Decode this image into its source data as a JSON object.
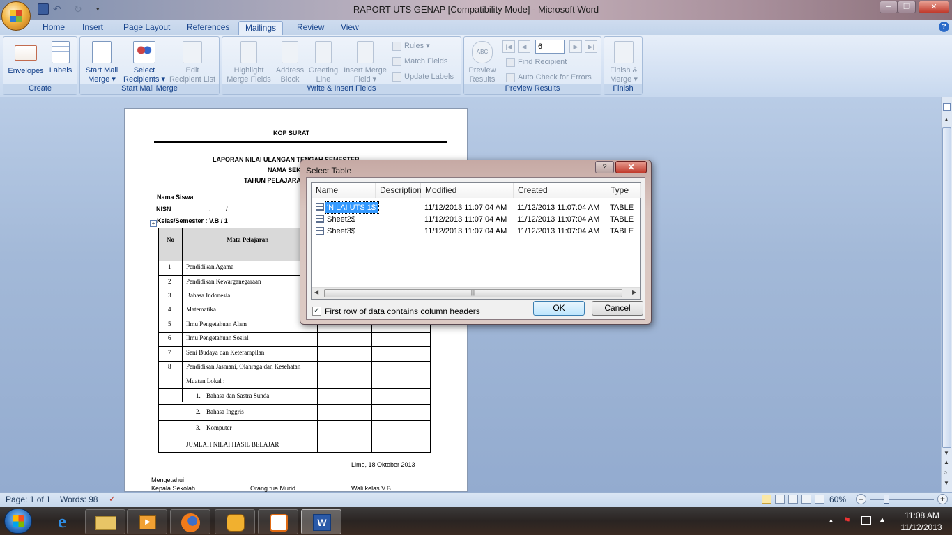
{
  "window": {
    "title": "RAPORT UTS GENAP [Compatibility Mode] - Microsoft Word"
  },
  "tabs": [
    "Home",
    "Insert",
    "Page Layout",
    "References",
    "Mailings",
    "Review",
    "View"
  ],
  "ribbon": {
    "create": {
      "label": "Create",
      "envelopes": "Envelopes",
      "labels": "Labels"
    },
    "start_mail_merge": {
      "label": "Start Mail Merge",
      "start_l1": "Start Mail",
      "start_l2": "Merge ▾",
      "select_l1": "Select",
      "select_l2": "Recipients ▾",
      "edit_l1": "Edit",
      "edit_l2": "Recipient List"
    },
    "write_insert": {
      "label": "Write & Insert Fields",
      "highlight_l1": "Highlight",
      "highlight_l2": "Merge Fields",
      "address_l1": "Address",
      "address_l2": "Block",
      "greeting_l1": "Greeting",
      "greeting_l2": "Line",
      "insert_l1": "Insert Merge",
      "insert_l2": "Field ▾",
      "rules": "Rules ▾",
      "match": "Match Fields",
      "update": "Update Labels"
    },
    "preview": {
      "label": "Preview Results",
      "preview_l1": "Preview",
      "preview_l2": "Results",
      "record": "6",
      "find": "Find Recipient",
      "auto_check": "Auto Check for Errors"
    },
    "finish": {
      "label": "Finish",
      "finish_l1": "Finish &",
      "finish_l2": "Merge ▾"
    }
  },
  "document": {
    "kop": "KOP SURAT",
    "laporan": "LAPORAN NILAI ULANGAN TENGAH SEMESTER",
    "nama_sek": "NAMA SEK",
    "tahun": "TAHUN PELAJARA",
    "nama_siswa": "Nama Siswa",
    "nisn": "NISN",
    "colon": ":",
    "slash": "/",
    "kelas": "Kelas/Semester : V.B  / 1",
    "table_no": "No",
    "table_mapel": "Mata Pelajaran",
    "rows": [
      {
        "no": "1",
        "name": "Pendidikan Agama"
      },
      {
        "no": "2",
        "name": "Pendidikan Kewarganegaraan"
      },
      {
        "no": "3",
        "name": "Bahasa Indonesia"
      },
      {
        "no": "4",
        "name": "Matematika"
      },
      {
        "no": "5",
        "name": "Ilmu Pengetahuan Alam"
      },
      {
        "no": "6",
        "name": "Ilmu Pengetahuan Sosial"
      },
      {
        "no": "7",
        "name": "Seni Budaya dan Keterampilan"
      },
      {
        "no": "8",
        "name": "Pendidikan Jasmani, Olahraga dan Kesehatan"
      }
    ],
    "muatan": "Muatan Lokal :",
    "muatan_items": [
      {
        "no": "1.",
        "name": "Bahasa dan Sastra Sunda"
      },
      {
        "no": "2.",
        "name": "Bahasa Inggris"
      },
      {
        "no": "3.",
        "name": "Komputer"
      }
    ],
    "jumlah": "JUMLAH NILAI HASIL BELAJAR",
    "date": "Limo, 18 Oktober 2013",
    "mengetahui": "Mengetahui",
    "kepala": "Kepala Sekolah",
    "ortu": "Orang tua Murid",
    "wali": "Wali kelas V.B"
  },
  "dialog": {
    "title": "Select Table",
    "help": "?",
    "columns": [
      "Name",
      "Description",
      "Modified",
      "Created",
      "Type"
    ],
    "rows": [
      {
        "name": "'NILAI UTS 1$'",
        "description": "",
        "modified": "11/12/2013 11:07:04 AM",
        "created": "11/12/2013 11:07:04 AM",
        "type": "TABLE",
        "selected": true
      },
      {
        "name": "Sheet2$",
        "description": "",
        "modified": "11/12/2013 11:07:04 AM",
        "created": "11/12/2013 11:07:04 AM",
        "type": "TABLE",
        "selected": false
      },
      {
        "name": "Sheet3$",
        "description": "",
        "modified": "11/12/2013 11:07:04 AM",
        "created": "11/12/2013 11:07:04 AM",
        "type": "TABLE",
        "selected": false
      }
    ],
    "checkbox_label": "First row of data contains column headers",
    "checkbox_checked": true,
    "ok": "OK",
    "cancel": "Cancel"
  },
  "status": {
    "page": "Page: 1 of 1",
    "words": "Words: 98",
    "zoom": "60%"
  },
  "taskbar": {
    "time": "11:08 AM",
    "date": "11/12/2013"
  },
  "colors": {
    "accent": "#15428b",
    "selection": "#3399ff",
    "ribbon": "#dde8f6"
  }
}
